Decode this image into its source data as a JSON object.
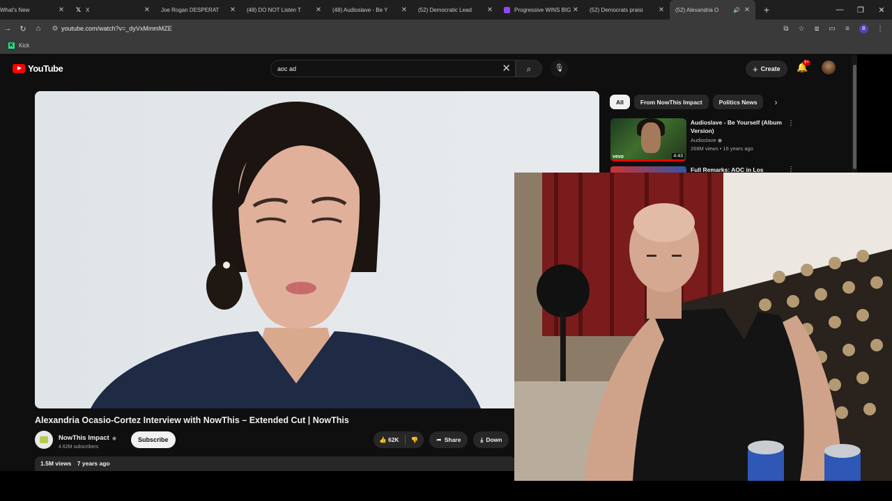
{
  "browser": {
    "tabs": [
      {
        "title": "What's New",
        "favicon": "none"
      },
      {
        "title": "X",
        "favicon": "x"
      },
      {
        "title": "Joe Rogan DESPERAT",
        "favicon": "youtube"
      },
      {
        "title": "(48) DO NOT Listen T",
        "favicon": "youtube"
      },
      {
        "title": "(48) Audioslave - Be Y",
        "favicon": "youtube"
      },
      {
        "title": "(52) Democratic Lead",
        "favicon": "youtube"
      },
      {
        "title": "Progressive WINS BIG",
        "favicon": "twitch"
      },
      {
        "title": "(52) Democrats praisi",
        "favicon": "youtube"
      },
      {
        "title": "(52) Alexandria O",
        "favicon": "youtube",
        "active": true
      }
    ],
    "url": "youtube.com/watch?v=_dyVxMmmMZE",
    "bookmarks": [
      {
        "label": "Kick"
      }
    ],
    "profile_initial": "B"
  },
  "youtube": {
    "logo_text": "YouTube",
    "search_value": "aoc ad",
    "create_label": "Create",
    "notifications_badge": "9+",
    "chips": [
      "All",
      "From NowThis Impact",
      "Politics News"
    ],
    "recommendations": [
      {
        "title": "Audioslave - Be Yourself (Album Version)",
        "channel": "Audioslave",
        "stats": "268M views • 16 years ago",
        "duration": "4:43",
        "badge": "vevo"
      },
      {
        "title": "Full Remarks: AOC in Los"
      }
    ],
    "video": {
      "title": "Alexandria Ocasio-Cortez Interview with NowThis – Extended Cut | NowThis",
      "channel": "NowThis Impact",
      "subscribers": "4.62M subscribers",
      "subscribe_label": "Subscribe",
      "likes": "62K",
      "share_label": "Share",
      "download_label": "Down",
      "views": "1.5M views",
      "age": "7 years ago"
    }
  },
  "colors": {
    "yt_bg": "#0f0f0f",
    "yt_red": "#ff0000",
    "chip_bg": "#272727"
  }
}
